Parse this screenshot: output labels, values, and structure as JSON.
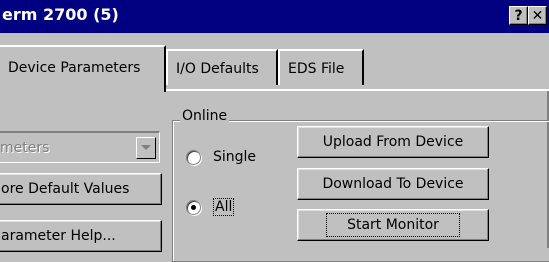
{
  "window": {
    "title": "erm 2700 (5)",
    "help_button": "?",
    "close_button": "✕"
  },
  "tabs": [
    {
      "label": "Device Parameters",
      "active": true
    },
    {
      "label": "I/O Defaults",
      "active": false
    },
    {
      "label": "EDS File",
      "active": false
    }
  ],
  "left": {
    "parameters_dropdown": "meters",
    "restore_button": "ore Default Values",
    "help_button": "arameter Help..."
  },
  "online_group": {
    "label": "Online",
    "radio_single": "Single",
    "radio_all": "All",
    "selected": "All",
    "upload_button": "Upload From Device",
    "download_button": "Download To Device",
    "monitor_button": "Start Monitor"
  }
}
